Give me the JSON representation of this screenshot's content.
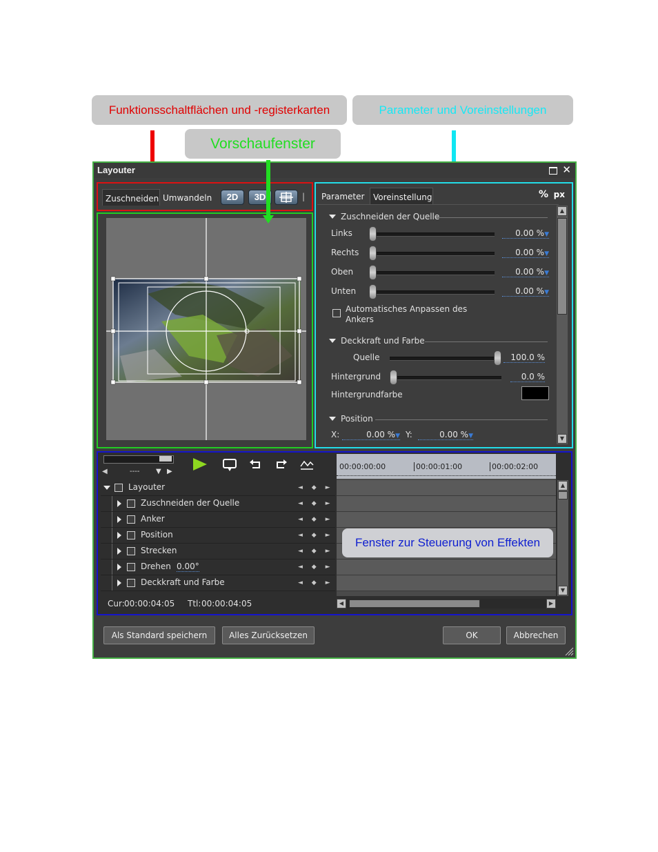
{
  "callouts": {
    "functions": {
      "text": "Funktionsschaltflächen und -registerkarten",
      "color": "#e00000"
    },
    "params": {
      "text": "Parameter und Voreinstellungen",
      "color": "#17e0f0"
    },
    "preview": {
      "text": "Vorschaufenster",
      "color": "#22dd22"
    },
    "effects": {
      "text": "Fenster zur Steuerung von Effekten",
      "color": "#1020d0"
    }
  },
  "window": {
    "title": "Layouter",
    "restore_icon": "restore-icon",
    "close_icon": "close-icon",
    "close_glyph": "✕"
  },
  "tabs": {
    "crop": "Zuschneiden",
    "transform": "Umwandeln",
    "btn_2d": "2D",
    "btn_3d": "3D",
    "separator": "|"
  },
  "params": {
    "tab_parameter": "Parameter",
    "tab_preset": "Voreinstellung",
    "unit_percent": "%",
    "unit_px": "px",
    "section_crop": "Zuschneiden der Quelle",
    "crop_rows": [
      {
        "label": "Links",
        "value": "0.00 %"
      },
      {
        "label": "Rechts",
        "value": "0.00 %"
      },
      {
        "label": "Oben",
        "value": "0.00 %"
      },
      {
        "label": "Unten",
        "value": "0.00 %"
      }
    ],
    "auto_anchor_line1": "Automatisches Anpassen des",
    "auto_anchor_line2": "Ankers",
    "section_opacity": "Deckkraft und Farbe",
    "source_label": "Quelle",
    "source_value": "100.0 %",
    "source_level": 1.0,
    "background_label": "Hintergrund",
    "background_value": "0.0 %",
    "background_level": 0.0,
    "bgcolor_label": "Hintergrundfarbe",
    "bgcolor": "#000000",
    "section_position": "Position",
    "x_label": "X:",
    "x_value": "0.00 %",
    "y_label": "Y:",
    "y_value": "0.00 %"
  },
  "effects": {
    "dropdown_value": "----",
    "tree": [
      {
        "label": "Layouter",
        "expanded": true,
        "extra": ""
      },
      {
        "label": "Zuschneiden der Quelle",
        "expanded": false,
        "extra": ""
      },
      {
        "label": "Anker",
        "expanded": false,
        "extra": ""
      },
      {
        "label": "Position",
        "expanded": false,
        "extra": ""
      },
      {
        "label": "Strecken",
        "expanded": false,
        "extra": ""
      },
      {
        "label": "Drehen",
        "expanded": false,
        "extra": "0.00°"
      },
      {
        "label": "Deckkraft und Farbe",
        "expanded": false,
        "extra": ""
      }
    ],
    "keyframe_glyphs": "◄ ◆ ►",
    "timecodes": [
      "00:00:00:00",
      "00:00:01:00",
      "00:00:02:00"
    ],
    "cur_label": "Cur:",
    "cur_value": "00:00:04:05",
    "ttl_label": "Ttl:",
    "ttl_value": "00:00:04:05"
  },
  "footer": {
    "save_default": "Als Standard speichern",
    "reset_all": "Alles Zurücksetzen",
    "ok": "OK",
    "cancel": "Abbrechen"
  }
}
